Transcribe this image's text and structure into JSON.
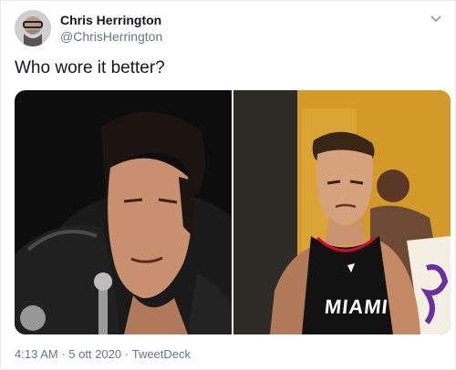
{
  "tweet": {
    "author": {
      "display_name": "Chris Herrington",
      "handle": "@ChrisHerrington"
    },
    "text": "Who wore it better?",
    "media": {
      "left_image": "Elvis-style performer in black leather jacket with microphone",
      "right_image": "Basketball player in black Miami jersey",
      "jersey_text": "MIAMI"
    },
    "footer": {
      "time": "4:13 AM",
      "sep1": "·",
      "date": "5 ott 2020",
      "sep2": "·",
      "source": "TweetDeck"
    }
  },
  "colors": {
    "text_primary": "#14171a",
    "text_secondary": "#657786",
    "border": "#e6ecf0"
  }
}
